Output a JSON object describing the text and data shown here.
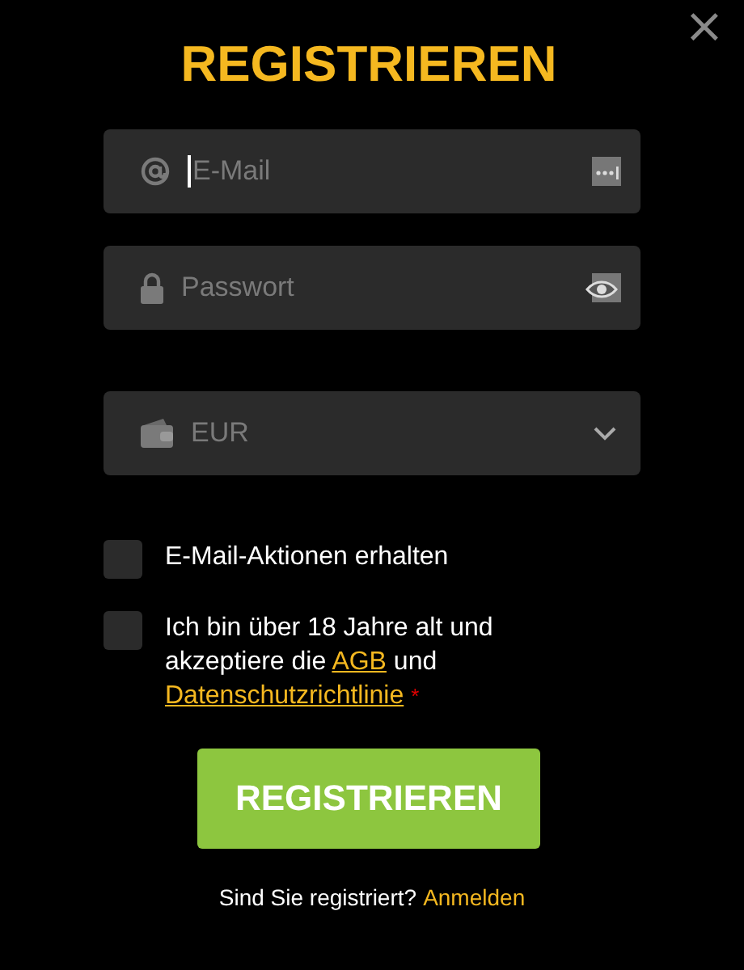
{
  "close": "×",
  "title": "REGISTRIEREN",
  "fields": [
    {
      "kind": "email",
      "placeholder": "E-Mail",
      "focused": true
    },
    {
      "kind": "password",
      "placeholder": "Passwort",
      "focused": false
    }
  ],
  "currency": {
    "value": "EUR"
  },
  "checkboxes": [
    {
      "kind": "plain",
      "label": "E-Mail-Aktionen erhalten",
      "checked": false
    },
    {
      "kind": "terms",
      "text_1": "Ich bin über 18 Jahre alt und akzeptiere die ",
      "link_1": "AGB",
      "text_2": " und ",
      "link_2": "Datenschutzrichtlinie",
      "required": "*",
      "checked": false
    }
  ],
  "submit": "REGISTRIEREN",
  "login": {
    "question": "Sind Sie registriert?",
    "link": "Anmelden"
  }
}
